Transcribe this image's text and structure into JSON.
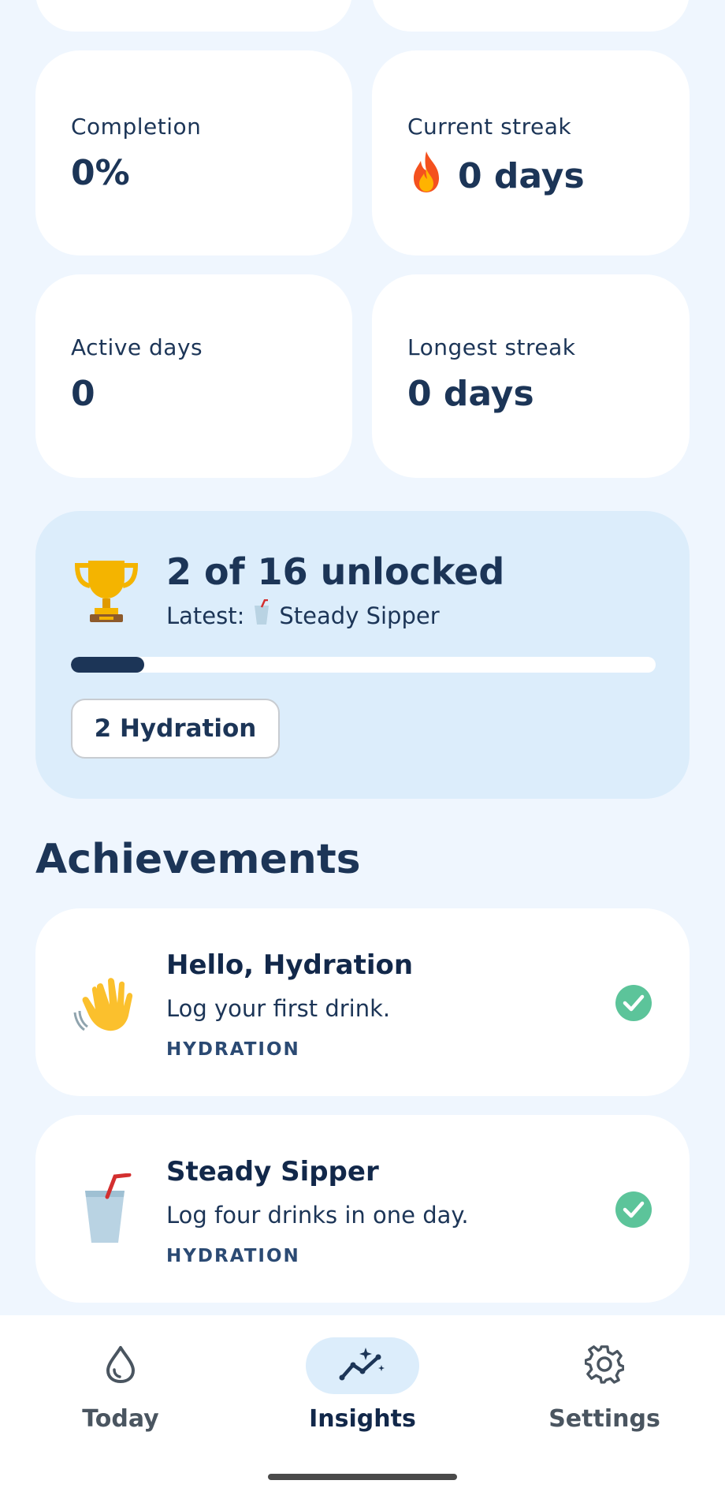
{
  "stats": {
    "completion": {
      "label": "Completion",
      "value": "0%"
    },
    "current_streak": {
      "label": "Current streak",
      "value": "0 days",
      "icon": "fire-icon"
    },
    "active_days": {
      "label": "Active days",
      "value": "0"
    },
    "longest_streak": {
      "label": "Longest streak",
      "value": "0 days"
    }
  },
  "summary": {
    "title": "2 of 16 unlocked",
    "latest_prefix": "Latest:",
    "latest_name": "Steady Sipper",
    "progress_fraction": 0.125,
    "chip_label": "2 Hydration",
    "colors": {
      "accent": "#1c3557",
      "panel": "#dcedfb"
    }
  },
  "achievements": {
    "title": "Achievements",
    "items": [
      {
        "title": "Hello, Hydration",
        "description": "Log your first drink.",
        "category": "HYDRATION",
        "icon": "waving-hand-icon",
        "unlocked": true
      },
      {
        "title": "Steady Sipper",
        "description": "Log four drinks in one day.",
        "category": "HYDRATION",
        "icon": "cup-with-straw-icon",
        "unlocked": true
      }
    ],
    "check_color": "#5cc49a"
  },
  "nav": {
    "items": [
      {
        "label": "Today",
        "icon": "water-drop-icon",
        "active": false
      },
      {
        "label": "Insights",
        "icon": "insights-chart-icon",
        "active": true
      },
      {
        "label": "Settings",
        "icon": "gear-icon",
        "active": false
      }
    ]
  }
}
